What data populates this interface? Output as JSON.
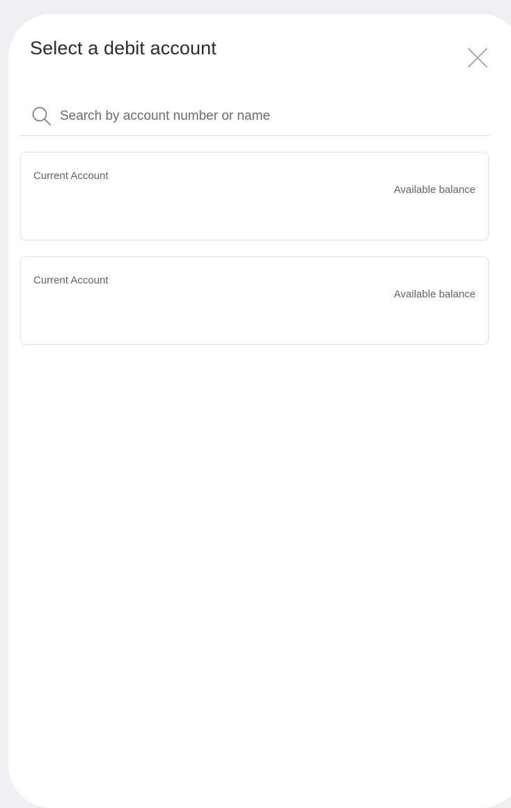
{
  "modal": {
    "title": "Select a debit account",
    "close_icon": "close-icon"
  },
  "search": {
    "placeholder": "Search by account number or name",
    "value": "",
    "icon": "search-icon"
  },
  "accounts": [
    {
      "type": "Current Account",
      "balance_label": "Available balance"
    },
    {
      "type": "Current Account",
      "balance_label": "Available balance"
    }
  ],
  "colors": {
    "backdrop": "#eeeef3",
    "sheet": "#ffffff",
    "title_text": "#2b2b2e",
    "secondary_text": "#626268",
    "card_border": "#e1e1e5"
  }
}
